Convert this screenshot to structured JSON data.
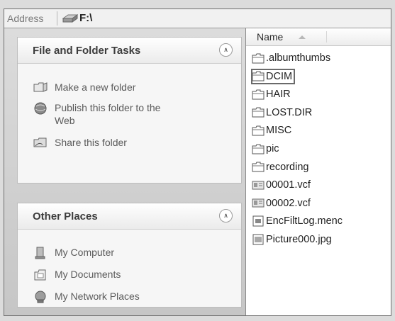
{
  "address_bar": {
    "label": "Address",
    "path": "F:\\"
  },
  "tasks_panel": {
    "title": "File and Folder Tasks",
    "items": [
      {
        "label": "Make a new folder",
        "icon": "new-folder-icon"
      },
      {
        "label": "Publish this folder to the",
        "label2": "Web",
        "icon": "publish-web-icon"
      },
      {
        "label": "Share this folder",
        "icon": "share-folder-icon"
      }
    ]
  },
  "places_panel": {
    "title": "Other Places",
    "items": [
      {
        "label": "My Computer",
        "icon": "my-computer-icon"
      },
      {
        "label": "My Documents",
        "icon": "my-documents-icon"
      },
      {
        "label": "My Network Places",
        "icon": "my-network-places-icon"
      }
    ]
  },
  "file_list": {
    "column_header": "Name",
    "selected": "DCIM",
    "items": [
      {
        "name": ".albumthumbs",
        "type": "folder"
      },
      {
        "name": "DCIM",
        "type": "folder"
      },
      {
        "name": "HAIR",
        "type": "folder"
      },
      {
        "name": "LOST.DIR",
        "type": "folder"
      },
      {
        "name": "MISC",
        "type": "folder"
      },
      {
        "name": "pic",
        "type": "folder"
      },
      {
        "name": "recording",
        "type": "folder"
      },
      {
        "name": "00001.vcf",
        "type": "vcard"
      },
      {
        "name": "00002.vcf",
        "type": "vcard"
      },
      {
        "name": "EncFiltLog.menc",
        "type": "generic"
      },
      {
        "name": "Picture000.jpg",
        "type": "image"
      }
    ]
  }
}
